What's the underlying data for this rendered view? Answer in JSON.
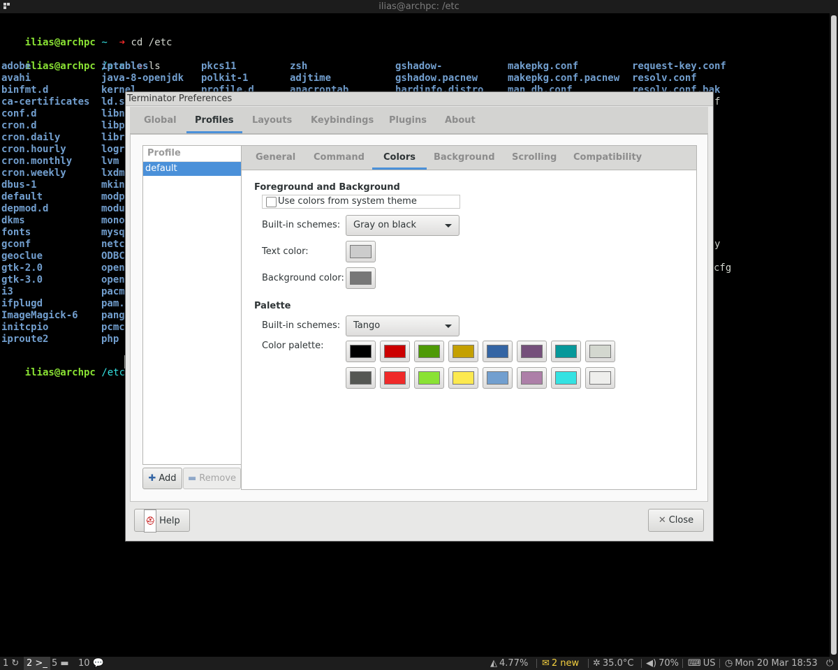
{
  "terminal": {
    "window_title": "ilias@archpc: /etc",
    "lines": [
      {
        "user": "ilias@archpc",
        "dir": "~",
        "cmd": "cd /etc"
      },
      {
        "user": "ilias@archpc",
        "dir": "/etc",
        "cmd": "ls"
      },
      {
        "user": "ilias@archpc",
        "dir": "/etc",
        "cmd": ""
      }
    ],
    "prompt_arrow": "➜",
    "ls_columns": [
      [
        "adobe",
        "avahi",
        "binfmt.d",
        "ca-certificates",
        "conf.d",
        "cron.d",
        "cron.daily",
        "cron.hourly",
        "cron.monthly",
        "cron.weekly",
        "dbus-1",
        "default",
        "depmod.d",
        "dkms",
        "fonts",
        "gconf",
        "geoclue",
        "gtk-2.0",
        "gtk-3.0",
        "i3",
        "ifplugd",
        "ImageMagick-6",
        "initcpio",
        "iproute2"
      ],
      [
        "iptables",
        "java-8-openjdk",
        "kernel",
        "ld.s",
        "libn",
        "libp",
        "libr",
        "logr",
        "lvm",
        "lxdm",
        "mkin",
        "modp",
        "modu",
        "mono",
        "mysq",
        "netc",
        "ODBC",
        "open",
        "open",
        "pacm",
        "pam.",
        "pang",
        "pcmc",
        "php"
      ],
      [
        "pkcs11",
        "polkit-1",
        "profile.d"
      ],
      [
        "zsh",
        "adjtime",
        "anacrontab"
      ],
      [
        "gshadow-",
        "gshadow.pacnew",
        "hardinfo.distro"
      ],
      [
        "makepkg.conf",
        "makepkg.conf.pacnew",
        "man_db.conf"
      ],
      [
        "request-key.conf",
        "resolv.conf",
        "resolv.conf.bak"
      ]
    ],
    "right_fragments": [
      {
        "row": 3,
        "text": "f"
      },
      {
        "row": 15,
        "text": "y"
      },
      {
        "row": 17,
        "text": "cfg"
      }
    ]
  },
  "dialog": {
    "title": "Terminator Preferences",
    "main_tabs": [
      "Global",
      "Profiles",
      "Layouts",
      "Keybindings",
      "Plugins",
      "About"
    ],
    "active_main_tab": "Profiles",
    "profile_header": "Profile",
    "profiles": [
      "default"
    ],
    "add_label": "Add",
    "remove_label": "Remove",
    "inner_tabs": [
      "General",
      "Command",
      "Colors",
      "Background",
      "Scrolling",
      "Compatibility"
    ],
    "active_inner_tab": "Colors",
    "fg_bg_title": "Foreground and Background",
    "use_system_theme_label": "Use colors from system theme",
    "use_system_theme_checked": false,
    "builtin_schemes_label": "Built-in schemes:",
    "fg_scheme_value": "Gray on black",
    "text_color_label": "Text color:",
    "text_color": "#cccccc",
    "bg_color_label": "Background color:",
    "bg_color": "#777777",
    "palette_title": "Palette",
    "palette_scheme_value": "Tango",
    "color_palette_label": "Color palette:",
    "palette_row1": [
      "#000000",
      "#cc0000",
      "#4e9a06",
      "#c4a000",
      "#3465a4",
      "#75507b",
      "#06989a",
      "#d3d7cf"
    ],
    "palette_row2": [
      "#555753",
      "#ef2929",
      "#8ae234",
      "#fce94f",
      "#729fcf",
      "#ad7fa8",
      "#34e2e2",
      "#eeeeec"
    ],
    "help_label": "Help",
    "close_label": "Close"
  },
  "statusbar": {
    "workspaces": [
      {
        "num": "1",
        "icon": "refresh-icon"
      },
      {
        "num": "2",
        "icon": "terminal-icon",
        "active": true
      },
      {
        "num": "5",
        "icon": "folder-icon"
      },
      {
        "num": "10",
        "icon": "chat-icon"
      }
    ],
    "cpu": "4.77%",
    "mail": "2 new",
    "temp": "35.0°C",
    "volume": "70%",
    "keyboard": "US",
    "datetime": "Mon 20 Mar 18:53"
  }
}
